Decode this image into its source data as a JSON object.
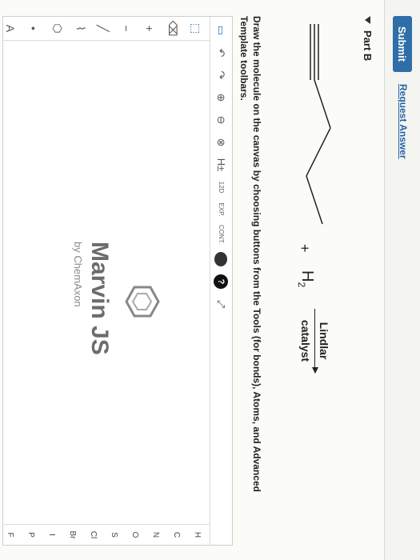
{
  "header": {
    "submit_label": "Submit",
    "request_answer_label": "Request Answer"
  },
  "part": {
    "title": "Part B"
  },
  "reaction": {
    "plus": "+",
    "reagent": "H",
    "reagent_sub": "2",
    "catalyst_top": "Lindlar",
    "catalyst_bottom": "catalyst"
  },
  "instructions": "Draw the molecule on the canvas by choosing buttons from the Tools (for bonds), Atoms, and Advanced Template toolbars.",
  "toolbar": {
    "h_plus": "H±",
    "iso_label": "12D",
    "exp_label": "EXP.",
    "cont_label": "CONT.",
    "help_label": "?"
  },
  "left_tools": {
    "plus": "+",
    "minus": "−"
  },
  "atoms": [
    "H",
    "C",
    "N",
    "O",
    "S",
    "Cl",
    "Br",
    "I",
    "P",
    "F"
  ],
  "brand": {
    "title": "Marvin JS",
    "by": "by ChemAxon"
  }
}
